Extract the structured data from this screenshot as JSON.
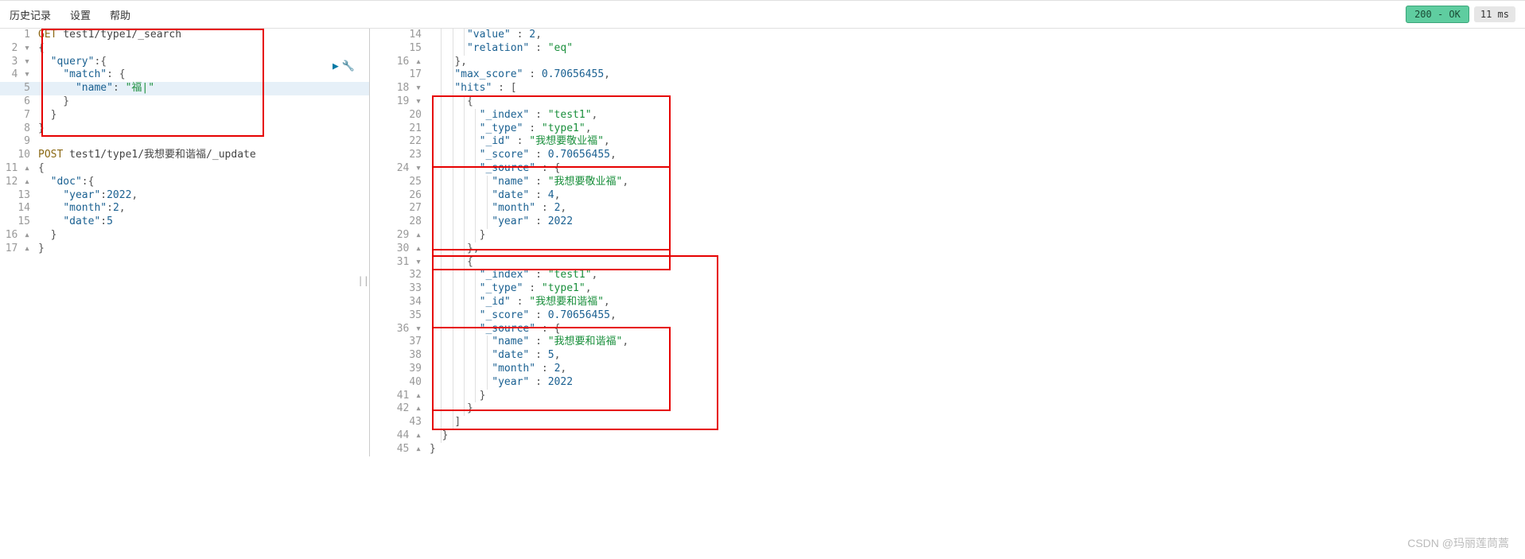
{
  "header": {
    "tabs": {
      "history": "历史记录",
      "settings": "设置",
      "help": "帮助"
    },
    "status": "200 - OK",
    "time": "11 ms"
  },
  "left": {
    "lines": [
      {
        "ln": "1",
        "content": [
          {
            "t": "GET ",
            "c": "method-get"
          },
          {
            "t": "test1/type1/_search",
            "c": "path"
          }
        ]
      },
      {
        "ln": "2",
        "fold": "▾",
        "content": [
          {
            "t": "{",
            "c": "p"
          }
        ]
      },
      {
        "ln": "3",
        "fold": "▾",
        "content": [
          {
            "t": "  ",
            "c": ""
          },
          {
            "t": "\"query\"",
            "c": "k"
          },
          {
            "t": ":{",
            "c": "p"
          }
        ]
      },
      {
        "ln": "4",
        "fold": "▾",
        "content": [
          {
            "t": "    ",
            "c": ""
          },
          {
            "t": "\"match\"",
            "c": "k"
          },
          {
            "t": ": {",
            "c": "p"
          }
        ]
      },
      {
        "ln": "5",
        "active": true,
        "content": [
          {
            "t": "      ",
            "c": ""
          },
          {
            "t": "\"name\"",
            "c": "k"
          },
          {
            "t": ": ",
            "c": "p"
          },
          {
            "t": "\"福|\"",
            "c": "s"
          }
        ]
      },
      {
        "ln": "6",
        "content": [
          {
            "t": "    }",
            "c": "p"
          }
        ]
      },
      {
        "ln": "7",
        "content": [
          {
            "t": "  }",
            "c": "p"
          }
        ]
      },
      {
        "ln": "8",
        "content": [
          {
            "t": "}",
            "c": "p"
          }
        ]
      },
      {
        "ln": "9",
        "content": []
      },
      {
        "ln": "10",
        "content": [
          {
            "t": "POST ",
            "c": "method-post"
          },
          {
            "t": "test1/type1/我想要和谐福/_update",
            "c": "path"
          }
        ]
      },
      {
        "ln": "11",
        "fold": "▴",
        "content": [
          {
            "t": "{",
            "c": "p"
          }
        ]
      },
      {
        "ln": "12",
        "fold": "▴",
        "content": [
          {
            "t": "  ",
            "c": ""
          },
          {
            "t": "\"doc\"",
            "c": "k"
          },
          {
            "t": ":{",
            "c": "p"
          }
        ]
      },
      {
        "ln": "13",
        "content": [
          {
            "t": "    ",
            "c": ""
          },
          {
            "t": "\"year\"",
            "c": "k"
          },
          {
            "t": ":",
            "c": "p"
          },
          {
            "t": "2022",
            "c": "n"
          },
          {
            "t": ",",
            "c": "p"
          }
        ]
      },
      {
        "ln": "14",
        "content": [
          {
            "t": "    ",
            "c": ""
          },
          {
            "t": "\"month\"",
            "c": "k"
          },
          {
            "t": ":",
            "c": "p"
          },
          {
            "t": "2",
            "c": "n"
          },
          {
            "t": ",",
            "c": "p"
          }
        ]
      },
      {
        "ln": "15",
        "content": [
          {
            "t": "    ",
            "c": ""
          },
          {
            "t": "\"date\"",
            "c": "k"
          },
          {
            "t": ":",
            "c": "p"
          },
          {
            "t": "5",
            "c": "n"
          }
        ]
      },
      {
        "ln": "16",
        "fold": "▴",
        "content": [
          {
            "t": "  }",
            "c": "p"
          }
        ]
      },
      {
        "ln": "17",
        "fold": "▴",
        "content": [
          {
            "t": "}",
            "c": "p"
          }
        ]
      }
    ]
  },
  "right": {
    "lines": [
      {
        "ln": "14",
        "in": 3,
        "content": [
          {
            "t": "\"value\"",
            "c": "k"
          },
          {
            "t": " : ",
            "c": "p"
          },
          {
            "t": "2",
            "c": "n"
          },
          {
            "t": ",",
            "c": "p"
          }
        ]
      },
      {
        "ln": "15",
        "in": 3,
        "content": [
          {
            "t": "\"relation\"",
            "c": "k"
          },
          {
            "t": " : ",
            "c": "p"
          },
          {
            "t": "\"eq\"",
            "c": "s"
          }
        ]
      },
      {
        "ln": "16",
        "fold": "▴",
        "in": 2,
        "content": [
          {
            "t": "},",
            "c": "p"
          }
        ]
      },
      {
        "ln": "17",
        "in": 2,
        "content": [
          {
            "t": "\"max_score\"",
            "c": "k"
          },
          {
            "t": " : ",
            "c": "p"
          },
          {
            "t": "0.70656455",
            "c": "n"
          },
          {
            "t": ",",
            "c": "p"
          }
        ]
      },
      {
        "ln": "18",
        "fold": "▾",
        "in": 2,
        "content": [
          {
            "t": "\"hits\"",
            "c": "k"
          },
          {
            "t": " : [",
            "c": "p"
          }
        ]
      },
      {
        "ln": "19",
        "fold": "▾",
        "in": 3,
        "content": [
          {
            "t": "{",
            "c": "p"
          }
        ]
      },
      {
        "ln": "20",
        "in": 4,
        "content": [
          {
            "t": "\"_index\"",
            "c": "k"
          },
          {
            "t": " : ",
            "c": "p"
          },
          {
            "t": "\"test1\"",
            "c": "s"
          },
          {
            "t": ",",
            "c": "p"
          }
        ]
      },
      {
        "ln": "21",
        "in": 4,
        "content": [
          {
            "t": "\"_type\"",
            "c": "k"
          },
          {
            "t": " : ",
            "c": "p"
          },
          {
            "t": "\"type1\"",
            "c": "s"
          },
          {
            "t": ",",
            "c": "p"
          }
        ]
      },
      {
        "ln": "22",
        "in": 4,
        "content": [
          {
            "t": "\"_id\"",
            "c": "k"
          },
          {
            "t": " : ",
            "c": "p"
          },
          {
            "t": "\"我想要敬业福\"",
            "c": "s"
          },
          {
            "t": ",",
            "c": "p"
          }
        ]
      },
      {
        "ln": "23",
        "in": 4,
        "content": [
          {
            "t": "\"_score\"",
            "c": "k"
          },
          {
            "t": " : ",
            "c": "p"
          },
          {
            "t": "0.70656455",
            "c": "n"
          },
          {
            "t": ",",
            "c": "p"
          }
        ]
      },
      {
        "ln": "24",
        "fold": "▾",
        "in": 4,
        "content": [
          {
            "t": "\"_source\"",
            "c": "k"
          },
          {
            "t": " : {",
            "c": "p"
          }
        ]
      },
      {
        "ln": "25",
        "in": 5,
        "content": [
          {
            "t": "\"name\"",
            "c": "k"
          },
          {
            "t": " : ",
            "c": "p"
          },
          {
            "t": "\"我想要敬业福\"",
            "c": "s"
          },
          {
            "t": ",",
            "c": "p"
          }
        ]
      },
      {
        "ln": "26",
        "in": 5,
        "content": [
          {
            "t": "\"date\"",
            "c": "k"
          },
          {
            "t": " : ",
            "c": "p"
          },
          {
            "t": "4",
            "c": "n"
          },
          {
            "t": ",",
            "c": "p"
          }
        ]
      },
      {
        "ln": "27",
        "in": 5,
        "content": [
          {
            "t": "\"month\"",
            "c": "k"
          },
          {
            "t": " : ",
            "c": "p"
          },
          {
            "t": "2",
            "c": "n"
          },
          {
            "t": ",",
            "c": "p"
          }
        ]
      },
      {
        "ln": "28",
        "in": 5,
        "content": [
          {
            "t": "\"year\"",
            "c": "k"
          },
          {
            "t": " : ",
            "c": "p"
          },
          {
            "t": "2022",
            "c": "n"
          }
        ]
      },
      {
        "ln": "29",
        "fold": "▴",
        "in": 4,
        "content": [
          {
            "t": "}",
            "c": "p"
          }
        ]
      },
      {
        "ln": "30",
        "fold": "▴",
        "in": 3,
        "content": [
          {
            "t": "},",
            "c": "p"
          }
        ]
      },
      {
        "ln": "31",
        "fold": "▾",
        "in": 3,
        "content": [
          {
            "t": "{",
            "c": "p"
          }
        ]
      },
      {
        "ln": "32",
        "in": 4,
        "content": [
          {
            "t": "\"_index\"",
            "c": "k"
          },
          {
            "t": " : ",
            "c": "p"
          },
          {
            "t": "\"test1\"",
            "c": "s"
          },
          {
            "t": ",",
            "c": "p"
          }
        ]
      },
      {
        "ln": "33",
        "in": 4,
        "content": [
          {
            "t": "\"_type\"",
            "c": "k"
          },
          {
            "t": " : ",
            "c": "p"
          },
          {
            "t": "\"type1\"",
            "c": "s"
          },
          {
            "t": ",",
            "c": "p"
          }
        ]
      },
      {
        "ln": "34",
        "in": 4,
        "content": [
          {
            "t": "\"_id\"",
            "c": "k"
          },
          {
            "t": " : ",
            "c": "p"
          },
          {
            "t": "\"我想要和谐福\"",
            "c": "s"
          },
          {
            "t": ",",
            "c": "p"
          }
        ]
      },
      {
        "ln": "35",
        "in": 4,
        "content": [
          {
            "t": "\"_score\"",
            "c": "k"
          },
          {
            "t": " : ",
            "c": "p"
          },
          {
            "t": "0.70656455",
            "c": "n"
          },
          {
            "t": ",",
            "c": "p"
          }
        ]
      },
      {
        "ln": "36",
        "fold": "▾",
        "in": 4,
        "content": [
          {
            "t": "\"_source\"",
            "c": "k"
          },
          {
            "t": " : {",
            "c": "p"
          }
        ]
      },
      {
        "ln": "37",
        "in": 5,
        "content": [
          {
            "t": "\"name\"",
            "c": "k"
          },
          {
            "t": " : ",
            "c": "p"
          },
          {
            "t": "\"我想要和谐福\"",
            "c": "s"
          },
          {
            "t": ",",
            "c": "p"
          }
        ]
      },
      {
        "ln": "38",
        "in": 5,
        "content": [
          {
            "t": "\"date\"",
            "c": "k"
          },
          {
            "t": " : ",
            "c": "p"
          },
          {
            "t": "5",
            "c": "n"
          },
          {
            "t": ",",
            "c": "p"
          }
        ]
      },
      {
        "ln": "39",
        "in": 5,
        "content": [
          {
            "t": "\"month\"",
            "c": "k"
          },
          {
            "t": " : ",
            "c": "p"
          },
          {
            "t": "2",
            "c": "n"
          },
          {
            "t": ",",
            "c": "p"
          }
        ]
      },
      {
        "ln": "40",
        "in": 5,
        "content": [
          {
            "t": "\"year\"",
            "c": "k"
          },
          {
            "t": " : ",
            "c": "p"
          },
          {
            "t": "2022",
            "c": "n"
          }
        ]
      },
      {
        "ln": "41",
        "fold": "▴",
        "in": 4,
        "content": [
          {
            "t": "}",
            "c": "p"
          }
        ]
      },
      {
        "ln": "42",
        "fold": "▴",
        "in": 3,
        "content": [
          {
            "t": "}",
            "c": "p"
          }
        ]
      },
      {
        "ln": "43",
        "in": 2,
        "content": [
          {
            "t": "]",
            "c": "p"
          }
        ]
      },
      {
        "ln": "44",
        "fold": "▴",
        "in": 1,
        "content": [
          {
            "t": "}",
            "c": "p"
          }
        ]
      },
      {
        "ln": "45",
        "fold": "▴",
        "in": 0,
        "content": [
          {
            "t": "}",
            "c": "p"
          }
        ]
      }
    ]
  },
  "watermark": "CSDN @玛丽莲茼蒿",
  "icons": {
    "run": "▶",
    "wrench": "🔧",
    "drag": "||"
  }
}
